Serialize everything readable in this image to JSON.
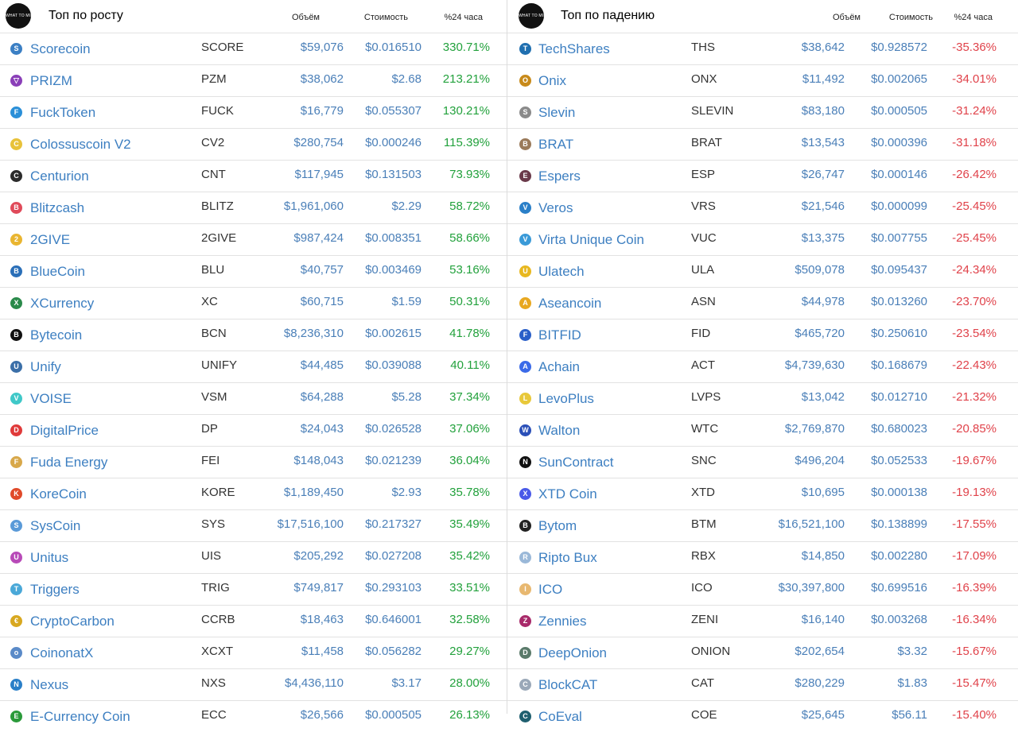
{
  "left": {
    "title": "Топ по росту",
    "logo_text": "WHAT TO MINE",
    "columns": {
      "volume": "Объём",
      "price": "Стоимость",
      "change": "%24 часа"
    },
    "rows": [
      {
        "name": "Scorecoin",
        "symbol": "SCORE",
        "volume": "$59,076",
        "price": "$0.016510",
        "change": "330.71%",
        "icon": "scorecoin-icon",
        "icon_color": "#3b7fc4",
        "glyph": "S"
      },
      {
        "name": "PRIZM",
        "symbol": "PZM",
        "volume": "$38,062",
        "price": "$2.68",
        "change": "213.21%",
        "icon": "prizm-icon",
        "icon_color": "#8a3fb8",
        "glyph": "▽"
      },
      {
        "name": "FuckToken",
        "symbol": "FUCK",
        "volume": "$16,779",
        "price": "$0.055307",
        "change": "130.21%",
        "icon": "fucktoken-icon",
        "icon_color": "#2a8fd8",
        "glyph": "F"
      },
      {
        "name": "Colossuscoin V2",
        "symbol": "CV2",
        "volume": "$280,754",
        "price": "$0.000246",
        "change": "115.39%",
        "icon": "colossuscoin-icon",
        "icon_color": "#e8c23a",
        "glyph": "C"
      },
      {
        "name": "Centurion",
        "symbol": "CNT",
        "volume": "$117,945",
        "price": "$0.131503",
        "change": "73.93%",
        "icon": "centurion-icon",
        "icon_color": "#2b2b2b",
        "glyph": "C"
      },
      {
        "name": "Blitzcash",
        "symbol": "BLITZ",
        "volume": "$1,961,060",
        "price": "$2.29",
        "change": "58.72%",
        "icon": "blitzcash-icon",
        "icon_color": "#e04a5a",
        "glyph": "B"
      },
      {
        "name": "2GIVE",
        "symbol": "2GIVE",
        "volume": "$987,424",
        "price": "$0.008351",
        "change": "58.66%",
        "icon": "2give-icon",
        "icon_color": "#e9b530",
        "glyph": "2"
      },
      {
        "name": "BlueCoin",
        "symbol": "BLU",
        "volume": "$40,757",
        "price": "$0.003469",
        "change": "53.16%",
        "icon": "bluecoin-icon",
        "icon_color": "#2a6fb8",
        "glyph": "B"
      },
      {
        "name": "XCurrency",
        "symbol": "XC",
        "volume": "$60,715",
        "price": "$1.59",
        "change": "50.31%",
        "icon": "xcurrency-icon",
        "icon_color": "#2a8a4a",
        "glyph": "X"
      },
      {
        "name": "Bytecoin",
        "symbol": "BCN",
        "volume": "$8,236,310",
        "price": "$0.002615",
        "change": "41.78%",
        "icon": "bytecoin-icon",
        "icon_color": "#111111",
        "glyph": "B"
      },
      {
        "name": "Unify",
        "symbol": "UNIFY",
        "volume": "$44,485",
        "price": "$0.039088",
        "change": "40.11%",
        "icon": "unify-icon",
        "icon_color": "#3b6fa8",
        "glyph": "U"
      },
      {
        "name": "VOISE",
        "symbol": "VSM",
        "volume": "$64,288",
        "price": "$5.28",
        "change": "37.34%",
        "icon": "voise-icon",
        "icon_color": "#3fc8c8",
        "glyph": "V"
      },
      {
        "name": "DigitalPrice",
        "symbol": "DP",
        "volume": "$24,043",
        "price": "$0.026528",
        "change": "37.06%",
        "icon": "digitalprice-icon",
        "icon_color": "#e03a3a",
        "glyph": "D"
      },
      {
        "name": "Fuda Energy",
        "symbol": "FEI",
        "volume": "$148,043",
        "price": "$0.021239",
        "change": "36.04%",
        "icon": "fuda-energy-icon",
        "icon_color": "#d8a84a",
        "glyph": "F"
      },
      {
        "name": "KoreCoin",
        "symbol": "KORE",
        "volume": "$1,189,450",
        "price": "$2.93",
        "change": "35.78%",
        "icon": "korecoin-icon",
        "icon_color": "#e04a2a",
        "glyph": "K"
      },
      {
        "name": "SysCoin",
        "symbol": "SYS",
        "volume": "$17,516,100",
        "price": "$0.217327",
        "change": "35.49%",
        "icon": "syscoin-icon",
        "icon_color": "#5a9ad8",
        "glyph": "S"
      },
      {
        "name": "Unitus",
        "symbol": "UIS",
        "volume": "$205,292",
        "price": "$0.027208",
        "change": "35.42%",
        "icon": "unitus-icon",
        "icon_color": "#b84ab8",
        "glyph": "U"
      },
      {
        "name": "Triggers",
        "symbol": "TRIG",
        "volume": "$749,817",
        "price": "$0.293103",
        "change": "33.51%",
        "icon": "triggers-icon",
        "icon_color": "#4aa8d8",
        "glyph": "T"
      },
      {
        "name": "CryptoCarbon",
        "symbol": "CCRB",
        "volume": "$18,463",
        "price": "$0.646001",
        "change": "32.58%",
        "icon": "cryptocarbon-icon",
        "icon_color": "#d8a820",
        "glyph": "€"
      },
      {
        "name": "CoinonatX",
        "symbol": "XCXT",
        "volume": "$11,458",
        "price": "$0.056282",
        "change": "29.27%",
        "icon": "coinonatx-icon",
        "icon_color": "#5a8ac8",
        "glyph": "o"
      },
      {
        "name": "Nexus",
        "symbol": "NXS",
        "volume": "$4,436,110",
        "price": "$3.17",
        "change": "28.00%",
        "icon": "nexus-icon",
        "icon_color": "#2a7fc8",
        "glyph": "N"
      },
      {
        "name": "E-Currency Coin",
        "symbol": "ECC",
        "volume": "$26,566",
        "price": "$0.000505",
        "change": "26.13%",
        "icon": "e-currency-coin-icon",
        "icon_color": "#2a9a3a",
        "glyph": "E"
      }
    ]
  },
  "right": {
    "title": "Топ по падению",
    "logo_text": "WHAT TO MINE",
    "columns": {
      "volume": "Объём",
      "price": "Стоимость",
      "change": "%24 часа"
    },
    "rows": [
      {
        "name": "TechShares",
        "symbol": "THS",
        "volume": "$38,642",
        "price": "$0.928572",
        "change": "-35.36%",
        "icon": "techshares-icon",
        "icon_color": "#1f6fb0",
        "glyph": "T"
      },
      {
        "name": "Onix",
        "symbol": "ONX",
        "volume": "$11,492",
        "price": "$0.002065",
        "change": "-34.01%",
        "icon": "onix-icon",
        "icon_color": "#c88a1a",
        "glyph": "O"
      },
      {
        "name": "Slevin",
        "symbol": "SLEVIN",
        "volume": "$83,180",
        "price": "$0.000505",
        "change": "-31.24%",
        "icon": "slevin-icon",
        "icon_color": "#8a8a8a",
        "glyph": "S"
      },
      {
        "name": "BRAT",
        "symbol": "BRAT",
        "volume": "$13,543",
        "price": "$0.000396",
        "change": "-31.18%",
        "icon": "brat-icon",
        "icon_color": "#9a7a5a",
        "glyph": "B"
      },
      {
        "name": "Espers",
        "symbol": "ESP",
        "volume": "$26,747",
        "price": "$0.000146",
        "change": "-26.42%",
        "icon": "espers-icon",
        "icon_color": "#6a3a4a",
        "glyph": "E"
      },
      {
        "name": "Veros",
        "symbol": "VRS",
        "volume": "$21,546",
        "price": "$0.000099",
        "change": "-25.45%",
        "icon": "veros-icon",
        "icon_color": "#2a7fc8",
        "glyph": "V"
      },
      {
        "name": "Virta Unique Coin",
        "symbol": "VUC",
        "volume": "$13,375",
        "price": "$0.007755",
        "change": "-25.45%",
        "icon": "virta-unique-coin-icon",
        "icon_color": "#3a9ad8",
        "glyph": "V"
      },
      {
        "name": "Ulatech",
        "symbol": "ULA",
        "volume": "$509,078",
        "price": "$0.095437",
        "change": "-24.34%",
        "icon": "ulatech-icon",
        "icon_color": "#e8b820",
        "glyph": "U"
      },
      {
        "name": "Aseancoin",
        "symbol": "ASN",
        "volume": "$44,978",
        "price": "$0.013260",
        "change": "-23.70%",
        "icon": "aseancoin-icon",
        "icon_color": "#e8a820",
        "glyph": "A"
      },
      {
        "name": "BITFID",
        "symbol": "FID",
        "volume": "$465,720",
        "price": "$0.250610",
        "change": "-23.54%",
        "icon": "bitfid-icon",
        "icon_color": "#2a5fc8",
        "glyph": "F"
      },
      {
        "name": "Achain",
        "symbol": "ACT",
        "volume": "$4,739,630",
        "price": "$0.168679",
        "change": "-22.43%",
        "icon": "achain-icon",
        "icon_color": "#3a6ae8",
        "glyph": "A"
      },
      {
        "name": "LevoPlus",
        "symbol": "LVPS",
        "volume": "$13,042",
        "price": "$0.012710",
        "change": "-21.32%",
        "icon": "levoplus-icon",
        "icon_color": "#e8c83a",
        "glyph": "L"
      },
      {
        "name": "Walton",
        "symbol": "WTC",
        "volume": "$2,769,870",
        "price": "$0.680023",
        "change": "-20.85%",
        "icon": "walton-icon",
        "icon_color": "#2a4fb8",
        "glyph": "W"
      },
      {
        "name": "SunContract",
        "symbol": "SNC",
        "volume": "$496,204",
        "price": "$0.052533",
        "change": "-19.67%",
        "icon": "suncontract-icon",
        "icon_color": "#111111",
        "glyph": "N"
      },
      {
        "name": "XTD Coin",
        "symbol": "XTD",
        "volume": "$10,695",
        "price": "$0.000138",
        "change": "-19.13%",
        "icon": "xtd-coin-icon",
        "icon_color": "#4a5ae8",
        "glyph": "X"
      },
      {
        "name": "Bytom",
        "symbol": "BTM",
        "volume": "$16,521,100",
        "price": "$0.138899",
        "change": "-17.55%",
        "icon": "bytom-icon",
        "icon_color": "#222222",
        "glyph": "B"
      },
      {
        "name": "Ripto Bux",
        "symbol": "RBX",
        "volume": "$14,850",
        "price": "$0.002280",
        "change": "-17.09%",
        "icon": "ripto-bux-icon",
        "icon_color": "#9ab8d8",
        "glyph": "R"
      },
      {
        "name": "ICO",
        "symbol": "ICO",
        "volume": "$30,397,800",
        "price": "$0.699516",
        "change": "-16.39%",
        "icon": "ico-icon",
        "icon_color": "#e8b870",
        "glyph": "I"
      },
      {
        "name": "Zennies",
        "symbol": "ZENI",
        "volume": "$16,140",
        "price": "$0.003268",
        "change": "-16.34%",
        "icon": "zennies-icon",
        "icon_color": "#a82a6a",
        "glyph": "Z"
      },
      {
        "name": "DeepOnion",
        "symbol": "ONION",
        "volume": "$202,654",
        "price": "$3.32",
        "change": "-15.67%",
        "icon": "deeponion-icon",
        "icon_color": "#5a7a6a",
        "glyph": "D"
      },
      {
        "name": "BlockCAT",
        "symbol": "CAT",
        "volume": "$280,229",
        "price": "$1.83",
        "change": "-15.47%",
        "icon": "blockcat-icon",
        "icon_color": "#9aa8b8",
        "glyph": "C"
      },
      {
        "name": "CoEval",
        "symbol": "COE",
        "volume": "$25,645",
        "price": "$56.11",
        "change": "-15.40%",
        "icon": "coeval-icon",
        "icon_color": "#1f5f6f",
        "glyph": "C"
      }
    ]
  }
}
